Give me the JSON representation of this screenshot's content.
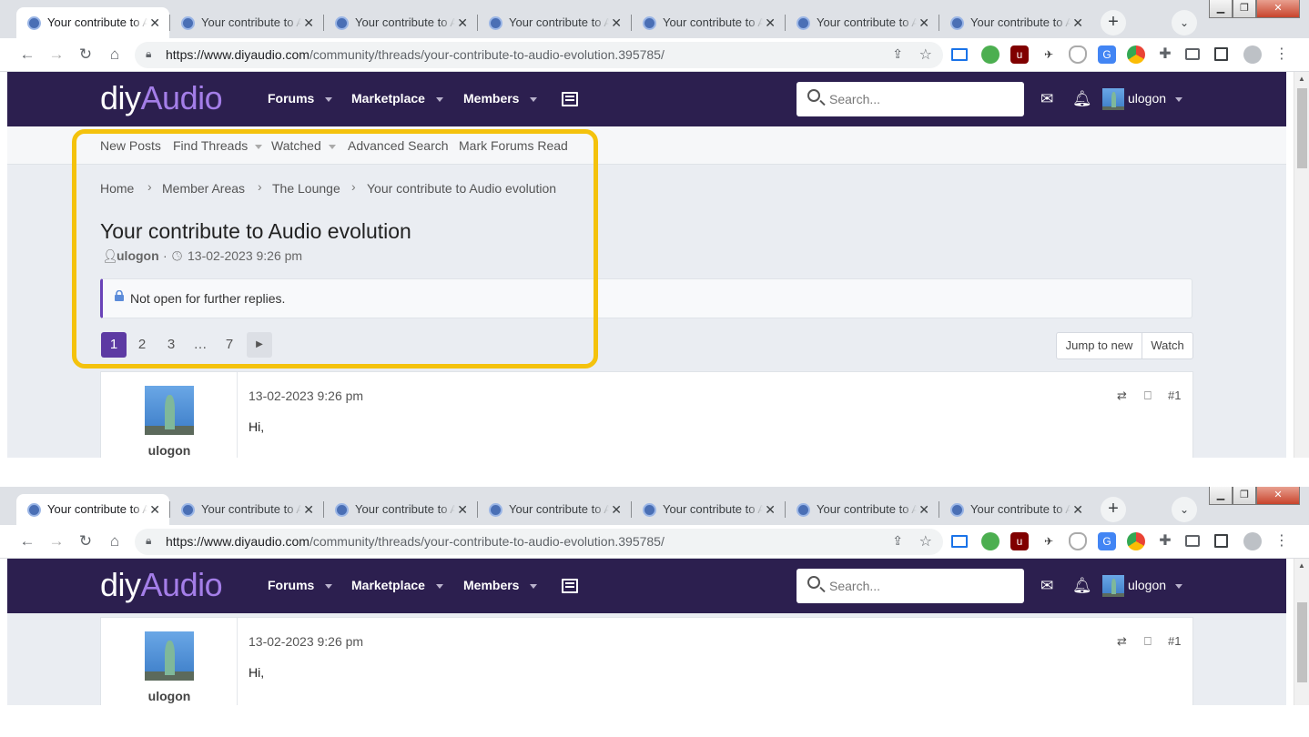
{
  "tabs": {
    "title": "Your contribute to Audio evolution",
    "close": "✕",
    "new_tab": "+"
  },
  "window": {
    "minimize": "▁",
    "restore": "❐",
    "close": "✕"
  },
  "browser": {
    "url_host": "https://www.diyaudio.com",
    "url_path": "/community/threads/your-contribute-to-audio-evolution.395785/"
  },
  "site": {
    "logo_prefix": "diy",
    "logo_suffix": "Audio",
    "nav": [
      "Forums",
      "Marketplace",
      "Members"
    ],
    "search_placeholder": "Search...",
    "username": "ulogon",
    "subnav": [
      "New Posts",
      "Find Threads",
      "Watched",
      "Advanced Search",
      "Mark Forums Read"
    ],
    "breadcrumb": [
      "Home",
      "Member Areas",
      "The Lounge",
      "Your contribute to Audio evolution"
    ],
    "thread_title": "Your contribute to Audio evolution",
    "author": "ulogon",
    "date": "13-02-2023 9:26 pm",
    "notice": "Not open for further replies.",
    "pages": [
      "1",
      "2",
      "3",
      "…",
      "7"
    ],
    "jump_label": "Jump to new",
    "watch_label": "Watch",
    "post": {
      "date": "13-02-2023 9:26 pm",
      "number": "#1",
      "body": "Hi,",
      "author": "ulogon"
    }
  }
}
